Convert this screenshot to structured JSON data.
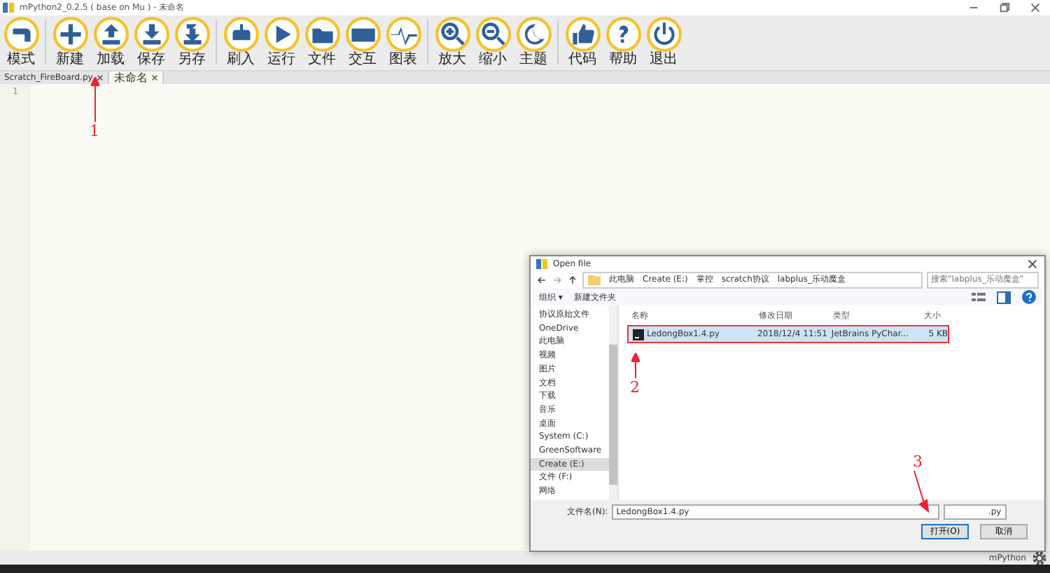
{
  "window": {
    "title": "mPython2_0.2.5 ( base on Mu ) - 未命名"
  },
  "toolbar": [
    [
      {
        "label": "模式"
      }
    ],
    [
      {
        "label": "新建"
      },
      {
        "label": "加载"
      },
      {
        "label": "保存"
      },
      {
        "label": "另存"
      }
    ],
    [
      {
        "label": "刷入"
      },
      {
        "label": "运行"
      },
      {
        "label": "文件"
      },
      {
        "label": "交互"
      },
      {
        "label": "图表"
      }
    ],
    [
      {
        "label": "放大"
      },
      {
        "label": "缩小"
      },
      {
        "label": "主题"
      }
    ],
    [
      {
        "label": "代码"
      },
      {
        "label": "帮助"
      },
      {
        "label": "退出"
      }
    ]
  ],
  "tabs": [
    {
      "label": "Scratch_FireBoard.py",
      "selected": false
    },
    {
      "label": "未命名",
      "selected": true
    }
  ],
  "editor": {
    "line_numbers": [
      "1"
    ]
  },
  "annotations": [
    {
      "label": "1"
    },
    {
      "label": "2"
    },
    {
      "label": "3"
    }
  ],
  "dialog": {
    "title": "Open file",
    "path": [
      "此电脑",
      "Create (E:)",
      "掌控",
      "scratch协议",
      "labplus_乐动魔盒"
    ],
    "search": {
      "placeholder": "搜索\"labplus_乐动魔盒\""
    },
    "commands": [
      "组织 ▾",
      "新建文件夹"
    ],
    "sidebar": [
      {
        "label": "协议原始文件",
        "selected": false
      },
      {
        "label": "OneDrive",
        "selected": false
      },
      {
        "label": "此电脑",
        "selected": false
      },
      {
        "label": "视频",
        "selected": false
      },
      {
        "label": "图片",
        "selected": false
      },
      {
        "label": "文档",
        "selected": false
      },
      {
        "label": "下载",
        "selected": false
      },
      {
        "label": "音乐",
        "selected": false
      },
      {
        "label": "桌面",
        "selected": false
      },
      {
        "label": "System (C:)",
        "selected": false
      },
      {
        "label": "GreenSoftware",
        "selected": false
      },
      {
        "label": "Create (E:)",
        "selected": true
      },
      {
        "label": "文件 (F:)",
        "selected": false
      },
      {
        "label": "网络",
        "selected": false
      }
    ],
    "columns": [
      "名称",
      "修改日期",
      "类型",
      "大小"
    ],
    "files": [
      {
        "name": "LedongBox1.4.py",
        "modified": "2018/12/4 11:51",
        "type": "JetBrains PyChar...",
        "size": "5 KB",
        "selected": true
      }
    ],
    "filename_label": "文件名(N):",
    "filename": "LedongBox1.4.py",
    "filter": ".py",
    "buttons": [
      "打开(O)",
      "取消"
    ]
  },
  "status_bar": {
    "mode": "mPython"
  }
}
